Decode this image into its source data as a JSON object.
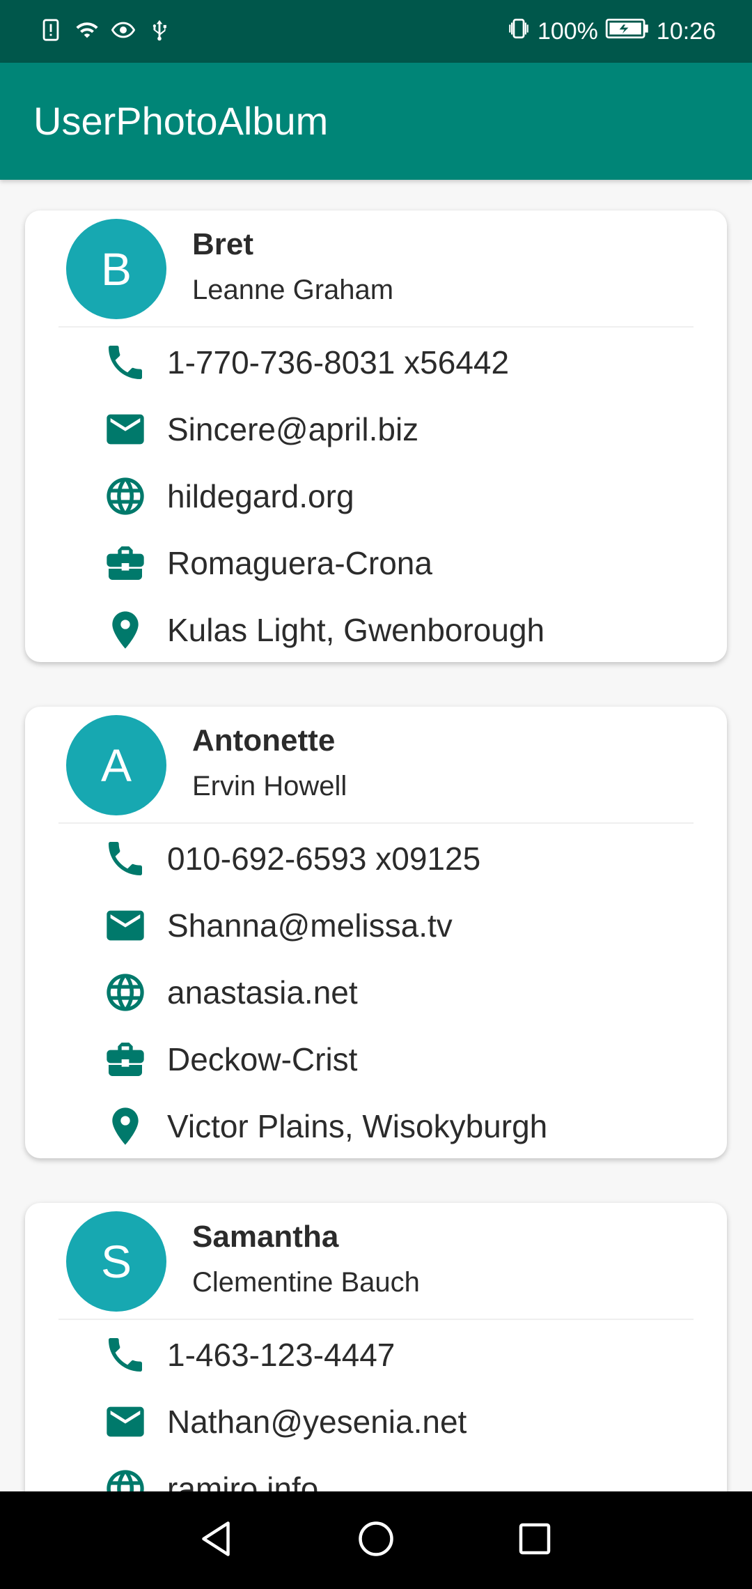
{
  "status_bar": {
    "battery": "100%",
    "time": "10:26",
    "left_icons": [
      "alert-icon",
      "wifi-icon",
      "eye-icon",
      "usb-icon"
    ],
    "right_icons": [
      "vibrate-icon",
      "battery-icon"
    ]
  },
  "app_bar": {
    "title": "UserPhotoAlbum",
    "color": "#008577"
  },
  "colors": {
    "status_bar": "#00574b",
    "avatar": "#17a8b1",
    "icon": "#00796b"
  },
  "users": [
    {
      "initial": "B",
      "username": "Bret",
      "name": "Leanne Graham",
      "phone": "1-770-736-8031 x56442",
      "email": "Sincere@april.biz",
      "website": "hildegard.org",
      "company": "Romaguera-Crona",
      "address": "Kulas Light, Gwenborough"
    },
    {
      "initial": "A",
      "username": "Antonette",
      "name": "Ervin Howell",
      "phone": "010-692-6593 x09125",
      "email": "Shanna@melissa.tv",
      "website": "anastasia.net",
      "company": "Deckow-Crist",
      "address": "Victor Plains, Wisokyburgh"
    },
    {
      "initial": "S",
      "username": "Samantha",
      "name": "Clementine Bauch",
      "phone": "1-463-123-4447",
      "email": "Nathan@yesenia.net",
      "website": "ramiro.info",
      "company": "",
      "address": ""
    }
  ],
  "nav_bar": {
    "buttons": [
      "back-icon",
      "home-icon",
      "recents-icon"
    ]
  }
}
